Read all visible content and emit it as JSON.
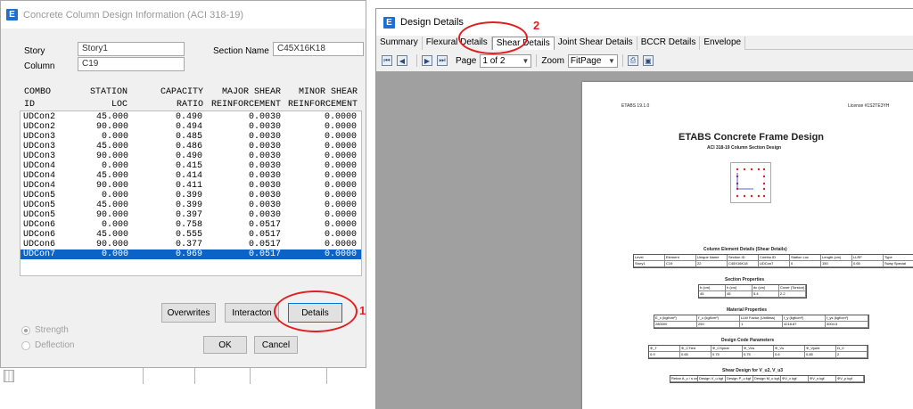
{
  "dialog": {
    "title": "Concrete Column Design Information (ACI 318-19)",
    "story_label": "Story",
    "story_value": "Story1",
    "column_label": "Column",
    "column_value": "C19",
    "section_label": "Section Name",
    "section_value": "C45X16K18",
    "headers": [
      [
        "COMBO",
        "ID"
      ],
      [
        "STATION",
        "LOC"
      ],
      [
        "CAPACITY",
        "RATIO"
      ],
      [
        "MAJOR SHEAR",
        "REINFORCEMENT"
      ],
      [
        "MINOR SHEAR",
        "REINFORCEMENT"
      ]
    ],
    "rows": [
      [
        "UDCon2",
        "45.000",
        "0.490",
        "0.0030",
        "0.0000"
      ],
      [
        "UDCon2",
        "90.000",
        "0.494",
        "0.0030",
        "0.0000"
      ],
      [
        "UDCon3",
        "0.000",
        "0.485",
        "0.0030",
        "0.0000"
      ],
      [
        "UDCon3",
        "45.000",
        "0.486",
        "0.0030",
        "0.0000"
      ],
      [
        "UDCon3",
        "90.000",
        "0.490",
        "0.0030",
        "0.0000"
      ],
      [
        "UDCon4",
        "0.000",
        "0.415",
        "0.0030",
        "0.0000"
      ],
      [
        "UDCon4",
        "45.000",
        "0.414",
        "0.0030",
        "0.0000"
      ],
      [
        "UDCon4",
        "90.000",
        "0.411",
        "0.0030",
        "0.0000"
      ],
      [
        "UDCon5",
        "0.000",
        "0.399",
        "0.0030",
        "0.0000"
      ],
      [
        "UDCon5",
        "45.000",
        "0.399",
        "0.0030",
        "0.0000"
      ],
      [
        "UDCon5",
        "90.000",
        "0.397",
        "0.0030",
        "0.0000"
      ],
      [
        "UDCon6",
        "0.000",
        "0.758",
        "0.0517",
        "0.0000"
      ],
      [
        "UDCon6",
        "45.000",
        "0.555",
        "0.0517",
        "0.0000"
      ],
      [
        "UDCon6",
        "90.000",
        "0.377",
        "0.0517",
        "0.0000"
      ],
      [
        "UDCon7",
        "0.000",
        "0.969",
        "0.0517",
        "0.0000"
      ]
    ],
    "selected_row_index": 14,
    "buttons": {
      "overwrites": "Overwrites",
      "interaction": "Interacton",
      "details": "Details",
      "ok": "OK",
      "cancel": "Cancel"
    },
    "radios": {
      "strength": "Strength",
      "deflection": "Deflection",
      "selected": "strength"
    }
  },
  "window": {
    "title": "Design Details",
    "tabs": [
      "Summary",
      "Flexural Details",
      "Shear Details",
      "Joint Shear Details",
      "BCCR Details",
      "Envelope"
    ],
    "active_tab": "Shear Details",
    "page_label": "Page",
    "page_value": "1 of 2",
    "zoom_label": "Zoom",
    "zoom_value": "FitPage",
    "report": {
      "header_left": "ETABS 19.1.0",
      "header_right": "License #1S2TE3YH",
      "title": "ETABS Concrete Frame Design",
      "subtitle": "ACI 318-19 Column Section Design",
      "element_details_title": "Column Element Details (Shear Details)",
      "element_headers": [
        "Level",
        "Element",
        "Unique Name",
        "Section ID",
        "Combo ID",
        "Station Loc",
        "Length (cm)",
        "LLRF",
        "Type"
      ],
      "element_values": [
        "Story1",
        "C19",
        "22",
        "C45X16K18",
        "UDCon7",
        "0",
        "150",
        "0.65",
        "Sway Special"
      ],
      "section_props_title": "Section Properties",
      "section_headers": [
        "b (cm)",
        "h (cm)",
        "dc (cm)",
        "Cover (Torsion) (cm)"
      ],
      "section_values": [
        "45",
        "45",
        "5.4",
        "2.2"
      ],
      "material_title": "Material Properties",
      "material_headers": [
        "E_c (kgf/cm²)",
        "f'_c (kgf/cm²)",
        "LLW Factor (Unitless)",
        "f_y (kgf/cm²)",
        "f_ys (kgf/cm²)"
      ],
      "material_values": [
        "280000",
        "250",
        "1",
        "4218.87",
        "3004.5"
      ],
      "design_code_title": "Design Code Parameters",
      "design_headers": [
        "Φ_T",
        "Φ_CTied",
        "Φ_CSpiral",
        "Φ_Vns",
        "Φ_Vs",
        "Φ_Vjoint",
        "Ω_0"
      ],
      "design_values": [
        "0.9",
        "0.65",
        "0.75",
        "0.75",
        "0.6",
        "0.85",
        "2"
      ],
      "shear_title": "Shear Design for V_u2, V_u3",
      "shear_headers": [
        "Rebar A_v / s cm²/cm",
        "Design V_u kgf",
        "Design P_u kgf",
        "Design M_u kgf-cm",
        "ΦV_c kgf",
        "ΦV_s kgf",
        "ΦV_p kgf"
      ]
    }
  },
  "annotations": {
    "one": "1",
    "two": "2"
  },
  "colors": {
    "selection": "#0a64c8",
    "annotation": "#e02020",
    "accent": "#1f6fd1"
  }
}
